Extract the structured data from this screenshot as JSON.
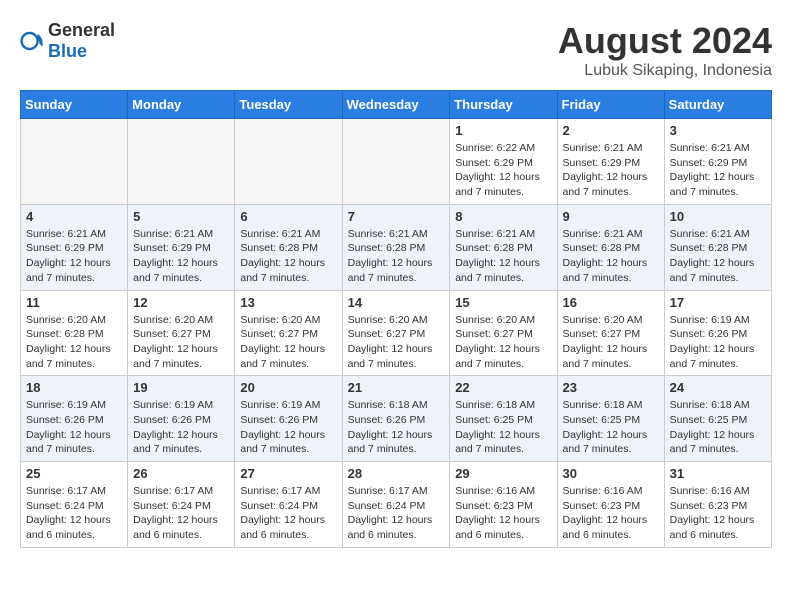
{
  "header": {
    "logo_general": "General",
    "logo_blue": "Blue",
    "month_year": "August 2024",
    "location": "Lubuk Sikaping, Indonesia"
  },
  "weekdays": [
    "Sunday",
    "Monday",
    "Tuesday",
    "Wednesday",
    "Thursday",
    "Friday",
    "Saturday"
  ],
  "weeks": [
    [
      {
        "day": "",
        "info": ""
      },
      {
        "day": "",
        "info": ""
      },
      {
        "day": "",
        "info": ""
      },
      {
        "day": "",
        "info": ""
      },
      {
        "day": "1",
        "sunrise": "6:22 AM",
        "sunset": "6:29 PM",
        "daylight": "12 hours and 7 minutes."
      },
      {
        "day": "2",
        "sunrise": "6:21 AM",
        "sunset": "6:29 PM",
        "daylight": "12 hours and 7 minutes."
      },
      {
        "day": "3",
        "sunrise": "6:21 AM",
        "sunset": "6:29 PM",
        "daylight": "12 hours and 7 minutes."
      }
    ],
    [
      {
        "day": "4",
        "sunrise": "6:21 AM",
        "sunset": "6:29 PM",
        "daylight": "12 hours and 7 minutes."
      },
      {
        "day": "5",
        "sunrise": "6:21 AM",
        "sunset": "6:29 PM",
        "daylight": "12 hours and 7 minutes."
      },
      {
        "day": "6",
        "sunrise": "6:21 AM",
        "sunset": "6:28 PM",
        "daylight": "12 hours and 7 minutes."
      },
      {
        "day": "7",
        "sunrise": "6:21 AM",
        "sunset": "6:28 PM",
        "daylight": "12 hours and 7 minutes."
      },
      {
        "day": "8",
        "sunrise": "6:21 AM",
        "sunset": "6:28 PM",
        "daylight": "12 hours and 7 minutes."
      },
      {
        "day": "9",
        "sunrise": "6:21 AM",
        "sunset": "6:28 PM",
        "daylight": "12 hours and 7 minutes."
      },
      {
        "day": "10",
        "sunrise": "6:21 AM",
        "sunset": "6:28 PM",
        "daylight": "12 hours and 7 minutes."
      }
    ],
    [
      {
        "day": "11",
        "sunrise": "6:20 AM",
        "sunset": "6:28 PM",
        "daylight": "12 hours and 7 minutes."
      },
      {
        "day": "12",
        "sunrise": "6:20 AM",
        "sunset": "6:27 PM",
        "daylight": "12 hours and 7 minutes."
      },
      {
        "day": "13",
        "sunrise": "6:20 AM",
        "sunset": "6:27 PM",
        "daylight": "12 hours and 7 minutes."
      },
      {
        "day": "14",
        "sunrise": "6:20 AM",
        "sunset": "6:27 PM",
        "daylight": "12 hours and 7 minutes."
      },
      {
        "day": "15",
        "sunrise": "6:20 AM",
        "sunset": "6:27 PM",
        "daylight": "12 hours and 7 minutes."
      },
      {
        "day": "16",
        "sunrise": "6:20 AM",
        "sunset": "6:27 PM",
        "daylight": "12 hours and 7 minutes."
      },
      {
        "day": "17",
        "sunrise": "6:19 AM",
        "sunset": "6:26 PM",
        "daylight": "12 hours and 7 minutes."
      }
    ],
    [
      {
        "day": "18",
        "sunrise": "6:19 AM",
        "sunset": "6:26 PM",
        "daylight": "12 hours and 7 minutes."
      },
      {
        "day": "19",
        "sunrise": "6:19 AM",
        "sunset": "6:26 PM",
        "daylight": "12 hours and 7 minutes."
      },
      {
        "day": "20",
        "sunrise": "6:19 AM",
        "sunset": "6:26 PM",
        "daylight": "12 hours and 7 minutes."
      },
      {
        "day": "21",
        "sunrise": "6:18 AM",
        "sunset": "6:26 PM",
        "daylight": "12 hours and 7 minutes."
      },
      {
        "day": "22",
        "sunrise": "6:18 AM",
        "sunset": "6:25 PM",
        "daylight": "12 hours and 7 minutes."
      },
      {
        "day": "23",
        "sunrise": "6:18 AM",
        "sunset": "6:25 PM",
        "daylight": "12 hours and 7 minutes."
      },
      {
        "day": "24",
        "sunrise": "6:18 AM",
        "sunset": "6:25 PM",
        "daylight": "12 hours and 7 minutes."
      }
    ],
    [
      {
        "day": "25",
        "sunrise": "6:17 AM",
        "sunset": "6:24 PM",
        "daylight": "12 hours and 6 minutes."
      },
      {
        "day": "26",
        "sunrise": "6:17 AM",
        "sunset": "6:24 PM",
        "daylight": "12 hours and 6 minutes."
      },
      {
        "day": "27",
        "sunrise": "6:17 AM",
        "sunset": "6:24 PM",
        "daylight": "12 hours and 6 minutes."
      },
      {
        "day": "28",
        "sunrise": "6:17 AM",
        "sunset": "6:24 PM",
        "daylight": "12 hours and 6 minutes."
      },
      {
        "day": "29",
        "sunrise": "6:16 AM",
        "sunset": "6:23 PM",
        "daylight": "12 hours and 6 minutes."
      },
      {
        "day": "30",
        "sunrise": "6:16 AM",
        "sunset": "6:23 PM",
        "daylight": "12 hours and 6 minutes."
      },
      {
        "day": "31",
        "sunrise": "6:16 AM",
        "sunset": "6:23 PM",
        "daylight": "12 hours and 6 minutes."
      }
    ]
  ]
}
